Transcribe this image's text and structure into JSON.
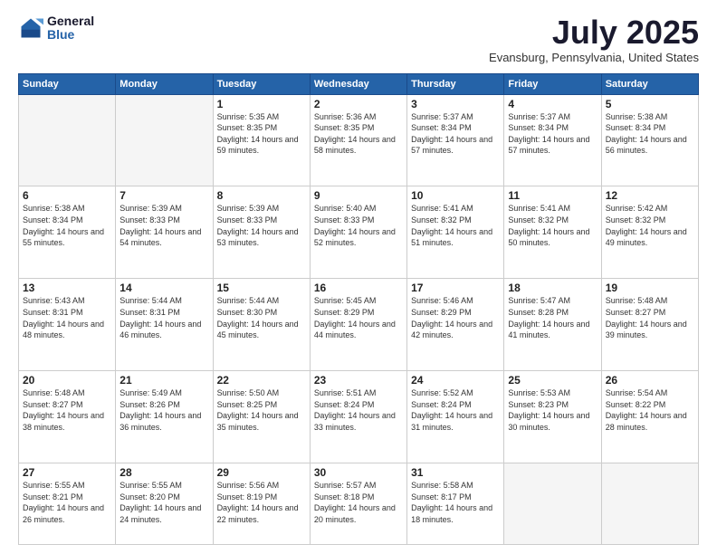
{
  "logo": {
    "general": "General",
    "blue": "Blue"
  },
  "title": "July 2025",
  "location": "Evansburg, Pennsylvania, United States",
  "days_of_week": [
    "Sunday",
    "Monday",
    "Tuesday",
    "Wednesday",
    "Thursday",
    "Friday",
    "Saturday"
  ],
  "weeks": [
    [
      {
        "day": "",
        "info": ""
      },
      {
        "day": "",
        "info": ""
      },
      {
        "day": "1",
        "info": "Sunrise: 5:35 AM\nSunset: 8:35 PM\nDaylight: 14 hours and 59 minutes."
      },
      {
        "day": "2",
        "info": "Sunrise: 5:36 AM\nSunset: 8:35 PM\nDaylight: 14 hours and 58 minutes."
      },
      {
        "day": "3",
        "info": "Sunrise: 5:37 AM\nSunset: 8:34 PM\nDaylight: 14 hours and 57 minutes."
      },
      {
        "day": "4",
        "info": "Sunrise: 5:37 AM\nSunset: 8:34 PM\nDaylight: 14 hours and 57 minutes."
      },
      {
        "day": "5",
        "info": "Sunrise: 5:38 AM\nSunset: 8:34 PM\nDaylight: 14 hours and 56 minutes."
      }
    ],
    [
      {
        "day": "6",
        "info": "Sunrise: 5:38 AM\nSunset: 8:34 PM\nDaylight: 14 hours and 55 minutes."
      },
      {
        "day": "7",
        "info": "Sunrise: 5:39 AM\nSunset: 8:33 PM\nDaylight: 14 hours and 54 minutes."
      },
      {
        "day": "8",
        "info": "Sunrise: 5:39 AM\nSunset: 8:33 PM\nDaylight: 14 hours and 53 minutes."
      },
      {
        "day": "9",
        "info": "Sunrise: 5:40 AM\nSunset: 8:33 PM\nDaylight: 14 hours and 52 minutes."
      },
      {
        "day": "10",
        "info": "Sunrise: 5:41 AM\nSunset: 8:32 PM\nDaylight: 14 hours and 51 minutes."
      },
      {
        "day": "11",
        "info": "Sunrise: 5:41 AM\nSunset: 8:32 PM\nDaylight: 14 hours and 50 minutes."
      },
      {
        "day": "12",
        "info": "Sunrise: 5:42 AM\nSunset: 8:32 PM\nDaylight: 14 hours and 49 minutes."
      }
    ],
    [
      {
        "day": "13",
        "info": "Sunrise: 5:43 AM\nSunset: 8:31 PM\nDaylight: 14 hours and 48 minutes."
      },
      {
        "day": "14",
        "info": "Sunrise: 5:44 AM\nSunset: 8:31 PM\nDaylight: 14 hours and 46 minutes."
      },
      {
        "day": "15",
        "info": "Sunrise: 5:44 AM\nSunset: 8:30 PM\nDaylight: 14 hours and 45 minutes."
      },
      {
        "day": "16",
        "info": "Sunrise: 5:45 AM\nSunset: 8:29 PM\nDaylight: 14 hours and 44 minutes."
      },
      {
        "day": "17",
        "info": "Sunrise: 5:46 AM\nSunset: 8:29 PM\nDaylight: 14 hours and 42 minutes."
      },
      {
        "day": "18",
        "info": "Sunrise: 5:47 AM\nSunset: 8:28 PM\nDaylight: 14 hours and 41 minutes."
      },
      {
        "day": "19",
        "info": "Sunrise: 5:48 AM\nSunset: 8:27 PM\nDaylight: 14 hours and 39 minutes."
      }
    ],
    [
      {
        "day": "20",
        "info": "Sunrise: 5:48 AM\nSunset: 8:27 PM\nDaylight: 14 hours and 38 minutes."
      },
      {
        "day": "21",
        "info": "Sunrise: 5:49 AM\nSunset: 8:26 PM\nDaylight: 14 hours and 36 minutes."
      },
      {
        "day": "22",
        "info": "Sunrise: 5:50 AM\nSunset: 8:25 PM\nDaylight: 14 hours and 35 minutes."
      },
      {
        "day": "23",
        "info": "Sunrise: 5:51 AM\nSunset: 8:24 PM\nDaylight: 14 hours and 33 minutes."
      },
      {
        "day": "24",
        "info": "Sunrise: 5:52 AM\nSunset: 8:24 PM\nDaylight: 14 hours and 31 minutes."
      },
      {
        "day": "25",
        "info": "Sunrise: 5:53 AM\nSunset: 8:23 PM\nDaylight: 14 hours and 30 minutes."
      },
      {
        "day": "26",
        "info": "Sunrise: 5:54 AM\nSunset: 8:22 PM\nDaylight: 14 hours and 28 minutes."
      }
    ],
    [
      {
        "day": "27",
        "info": "Sunrise: 5:55 AM\nSunset: 8:21 PM\nDaylight: 14 hours and 26 minutes."
      },
      {
        "day": "28",
        "info": "Sunrise: 5:55 AM\nSunset: 8:20 PM\nDaylight: 14 hours and 24 minutes."
      },
      {
        "day": "29",
        "info": "Sunrise: 5:56 AM\nSunset: 8:19 PM\nDaylight: 14 hours and 22 minutes."
      },
      {
        "day": "30",
        "info": "Sunrise: 5:57 AM\nSunset: 8:18 PM\nDaylight: 14 hours and 20 minutes."
      },
      {
        "day": "31",
        "info": "Sunrise: 5:58 AM\nSunset: 8:17 PM\nDaylight: 14 hours and 18 minutes."
      },
      {
        "day": "",
        "info": ""
      },
      {
        "day": "",
        "info": ""
      }
    ]
  ]
}
